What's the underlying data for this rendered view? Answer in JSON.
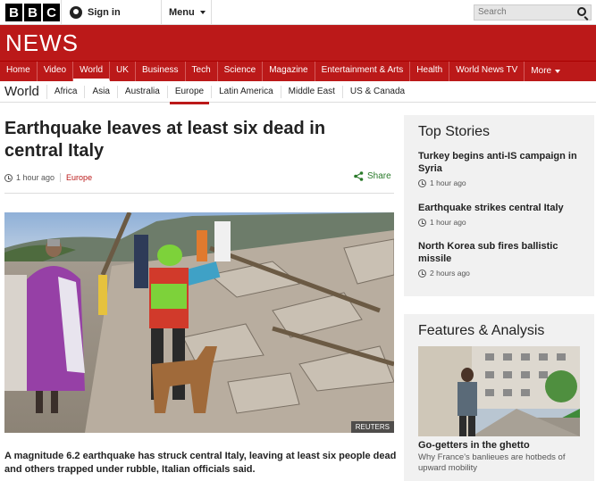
{
  "header": {
    "logo_letters": [
      "B",
      "B",
      "C"
    ],
    "sign_in": "Sign in",
    "menu": "Menu",
    "search_placeholder": "Search"
  },
  "banner": {
    "title": "NEWS"
  },
  "nav": {
    "items": [
      "Home",
      "Video",
      "World",
      "UK",
      "Business",
      "Tech",
      "Science",
      "Magazine",
      "Entertainment & Arts",
      "Health",
      "World News TV",
      "More"
    ],
    "active": "World"
  },
  "subnav": {
    "title": "World",
    "items": [
      "Africa",
      "Asia",
      "Australia",
      "Europe",
      "Latin America",
      "Middle East",
      "US & Canada"
    ],
    "active": "Europe"
  },
  "article": {
    "headline": "Earthquake leaves at least six dead in central Italy",
    "time": "1 hour ago",
    "section": "Europe",
    "share": "Share",
    "image_credit": "REUTERS",
    "summary": "A magnitude 6.2 earthquake has struck central Italy, leaving at least six people dead and others trapped under rubble, Italian officials said."
  },
  "top_stories": {
    "title": "Top Stories",
    "stories": [
      {
        "title": "Turkey begins anti-IS campaign in Syria",
        "time": "1 hour ago"
      },
      {
        "title": "Earthquake strikes central Italy",
        "time": "1 hour ago"
      },
      {
        "title": "North Korea sub fires ballistic missile",
        "time": "2 hours ago"
      }
    ]
  },
  "features": {
    "title": "Features & Analysis",
    "item_title": "Go-getters in the ghetto",
    "item_desc": "Why France's banlieues are hotbeds of upward mobility"
  },
  "colors": {
    "brand_red": "#bb1919",
    "share_green": "#2a7a2a",
    "sidebar_bg": "#f1f1f1"
  }
}
